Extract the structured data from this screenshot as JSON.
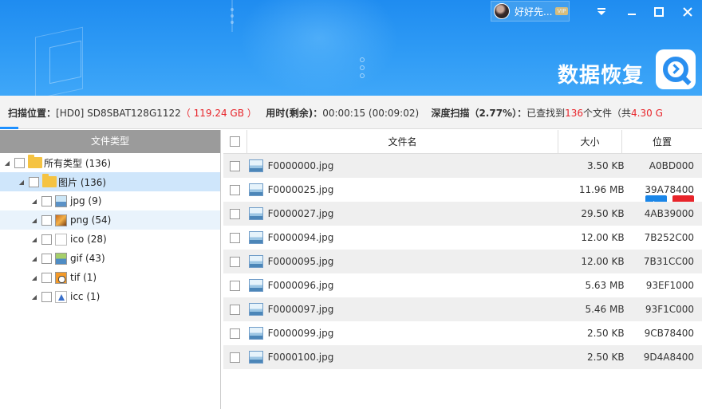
{
  "header": {
    "user_name": "好好先...",
    "vip_label": "VIP",
    "brand_text": "数据恢复",
    "window_controls": [
      "dropdown-icon",
      "minimize-icon",
      "maximize-icon",
      "close-icon"
    ],
    "accent_color": "#2a8ff0"
  },
  "status": {
    "scan_location_label": "扫描位置：",
    "drive": "[HD0] SD8SBAT128G1122",
    "drive_size": "（ 119.24 GB ）",
    "time_label": "用时(剩余)：",
    "time_value": "00:00:15 (00:09:02)",
    "deep_scan_label": "深度扫描（",
    "deep_scan_percent": "2.77%",
    "deep_scan_close": "）：",
    "found_prefix": "已查找到",
    "found_count": "136",
    "found_unit": "个文件（共",
    "found_size": "4.30 G",
    "progress_percent": 2.77,
    "play_color": "#1a86e8",
    "stop_color": "#e8242a"
  },
  "left_panel": {
    "header": "文件类型",
    "tree": [
      {
        "label": "所有类型 (136)",
        "icon": "folder-icon"
      },
      {
        "label": "图片 (136)",
        "icon": "folder-icon",
        "selected": true
      },
      {
        "label": "jpg (9)",
        "icon": "jpg-file-icon"
      },
      {
        "label": "png (54)",
        "icon": "png-file-icon",
        "hover": true
      },
      {
        "label": "ico (28)",
        "icon": "ico-file-icon"
      },
      {
        "label": "gif (43)",
        "icon": "gif-file-icon"
      },
      {
        "label": "tif (1)",
        "icon": "tif-file-icon"
      },
      {
        "label": "icc (1)",
        "icon": "icc-file-icon"
      }
    ]
  },
  "file_table": {
    "columns": [
      "文件名",
      "大小",
      "位置"
    ],
    "rows": [
      {
        "name": "F0000000.jpg",
        "size": "3.50 KB",
        "pos": "A0BD000"
      },
      {
        "name": "F0000025.jpg",
        "size": "11.96 MB",
        "pos": "39A78400"
      },
      {
        "name": "F0000027.jpg",
        "size": "29.50 KB",
        "pos": "4AB39000"
      },
      {
        "name": "F0000094.jpg",
        "size": "12.00 KB",
        "pos": "7B252C00"
      },
      {
        "name": "F0000095.jpg",
        "size": "12.00 KB",
        "pos": "7B31CC00"
      },
      {
        "name": "F0000096.jpg",
        "size": "5.63 MB",
        "pos": "93EF1000"
      },
      {
        "name": "F0000097.jpg",
        "size": "5.46 MB",
        "pos": "93F1C000"
      },
      {
        "name": "F0000099.jpg",
        "size": "2.50 KB",
        "pos": "9CB78400"
      },
      {
        "name": "F0000100.jpg",
        "size": "2.50 KB",
        "pos": "9D4A8400"
      }
    ]
  }
}
